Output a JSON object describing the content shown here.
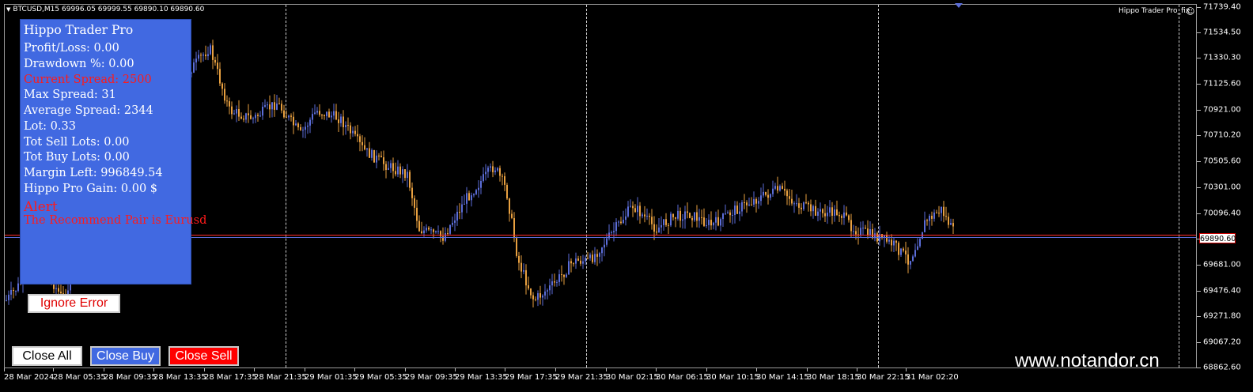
{
  "symbol_line": "BTCUSD,M15  69996.05 69999.55 69890.10 69890.60",
  "ea_name": "Hippo Trader Pro_fix",
  "smiley_icon": "smiley-icon",
  "current_price": "69890.60",
  "panel": {
    "title": "Hippo Trader Pro",
    "profit_loss": "Profit/Loss: 0.00",
    "drawdown": "Drawdown %: 0.00",
    "current_spread": "Current Spread: 2500",
    "max_spread": "Max Spread: 31",
    "average_spread": "Average Spread: 2344",
    "lot": "Lot: 0.33",
    "tot_sell_lots": "Tot Sell Lots: 0.00",
    "tot_buy_lots": "Tot Buy Lots: 0.00",
    "margin_left": "Margin Left: 996849.54",
    "gain": "Hippo Pro Gain: 0.00 $",
    "alert_title": "Alert",
    "alert_message": "The Recommend Pair is Eurusd"
  },
  "buttons": {
    "ignore_error": "Ignore Error",
    "close_all": "Close All",
    "close_buy": "Close Buy",
    "close_sell": "Close Sell"
  },
  "watermark": "www.notandor.cn",
  "price_axis": [
    "71739.40",
    "71534.50",
    "71330.30",
    "71125.60",
    "70921.00",
    "70710.20",
    "70505.60",
    "70301.00",
    "70096.40",
    "69890.60",
    "69681.00",
    "69476.40",
    "69271.80",
    "69067.20",
    "68862.60"
  ],
  "time_axis": [
    "28 Mar 2024",
    "28 Mar 05:35",
    "28 Mar 09:35",
    "28 Mar 13:35",
    "28 Mar 17:35",
    "28 Mar 21:35",
    "29 Mar 01:35",
    "29 Mar 05:35",
    "29 Mar 09:35",
    "29 Mar 13:35",
    "29 Mar 17:35",
    "29 Mar 21:35",
    "30 Mar 02:15",
    "30 Mar 06:15",
    "30 Mar 10:15",
    "30 Mar 14:15",
    "30 Mar 18:15",
    "30 Mar 22:15",
    "31 Mar 02:20"
  ],
  "colors": {
    "panel_bg": "#4169e1",
    "bull_candle": "#5b6dd8",
    "bear_candle": "#e8a040",
    "bid_line": "#ff2a2a",
    "ask_line": "#5b6dd8",
    "alert_text": "#ff1a1a"
  }
}
